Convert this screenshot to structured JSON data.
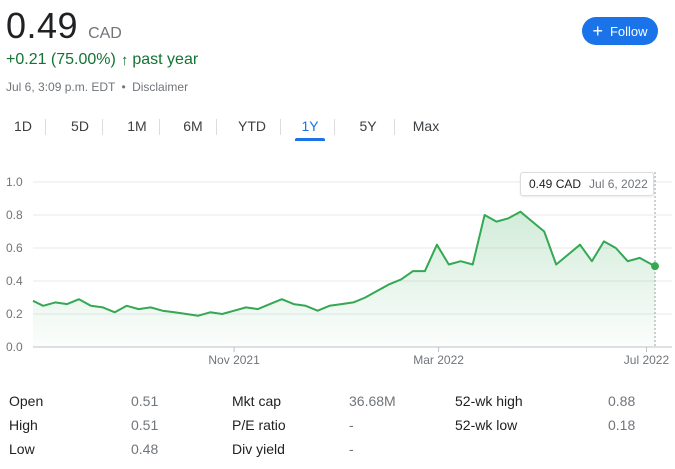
{
  "quote": {
    "price": "0.49",
    "currency": "CAD",
    "change": "+0.21 (75.00%)",
    "change_arrow": "↑",
    "change_period": "past year",
    "timestamp": "Jul 6, 3:09 p.m. EDT",
    "separator": "•",
    "disclaimer": "Disclaimer"
  },
  "follow_button": {
    "icon": "plus-icon",
    "label": "Follow",
    "color": "#1a73e8"
  },
  "tabs": [
    "1D",
    "5D",
    "1M",
    "6M",
    "YTD",
    "1Y",
    "5Y",
    "Max"
  ],
  "active_tab": "1Y",
  "tooltip": {
    "value": "0.49 CAD",
    "date": "Jul 6, 2022"
  },
  "chart_data": {
    "type": "area",
    "color": "#34a853",
    "ylim": [
      0,
      1.0
    ],
    "y_ticks": [
      "0.0",
      "0.2",
      "0.4",
      "0.6",
      "0.8",
      "1.0"
    ],
    "x_ticks": [
      "Nov 2021",
      "Mar 2022",
      "Jul 2022"
    ],
    "grid": true,
    "series": [
      {
        "x": [
          "2021-07-06",
          "2021-07-12",
          "2021-07-19",
          "2021-07-26",
          "2021-08-02",
          "2021-08-09",
          "2021-08-16",
          "2021-08-23",
          "2021-08-30",
          "2021-09-06",
          "2021-09-13",
          "2021-09-20",
          "2021-09-27",
          "2021-10-04",
          "2021-10-11",
          "2021-10-18",
          "2021-10-25",
          "2021-11-01",
          "2021-11-08",
          "2021-11-15",
          "2021-11-22",
          "2021-11-29",
          "2021-12-06",
          "2021-12-13",
          "2021-12-20",
          "2021-12-27",
          "2022-01-03",
          "2022-01-10",
          "2022-01-17",
          "2022-01-24",
          "2022-01-31",
          "2022-02-07",
          "2022-02-14",
          "2022-02-21",
          "2022-02-28",
          "2022-03-07",
          "2022-03-14",
          "2022-03-21",
          "2022-03-28",
          "2022-04-04",
          "2022-04-11",
          "2022-04-18",
          "2022-04-25",
          "2022-05-02",
          "2022-05-09",
          "2022-05-16",
          "2022-05-23",
          "2022-05-30",
          "2022-06-06",
          "2022-06-13",
          "2022-06-20",
          "2022-06-27",
          "2022-07-06"
        ],
        "y": [
          0.28,
          0.25,
          0.27,
          0.26,
          0.29,
          0.25,
          0.24,
          0.21,
          0.25,
          0.23,
          0.24,
          0.22,
          0.21,
          0.2,
          0.19,
          0.21,
          0.2,
          0.22,
          0.24,
          0.23,
          0.26,
          0.29,
          0.26,
          0.25,
          0.22,
          0.25,
          0.26,
          0.27,
          0.3,
          0.34,
          0.38,
          0.41,
          0.46,
          0.46,
          0.62,
          0.5,
          0.52,
          0.5,
          0.8,
          0.76,
          0.78,
          0.82,
          0.76,
          0.7,
          0.5,
          0.56,
          0.62,
          0.52,
          0.64,
          0.6,
          0.52,
          0.54,
          0.49
        ]
      }
    ]
  },
  "stats": [
    {
      "label": "Open",
      "value": "0.51"
    },
    {
      "label": "High",
      "value": "0.51"
    },
    {
      "label": "Low",
      "value": "0.48"
    },
    {
      "label": "Mkt cap",
      "value": "36.68M"
    },
    {
      "label": "P/E ratio",
      "value": "-"
    },
    {
      "label": "Div yield",
      "value": "-"
    },
    {
      "label": "52-wk high",
      "value": "0.88"
    },
    {
      "label": "52-wk low",
      "value": "0.18"
    }
  ]
}
